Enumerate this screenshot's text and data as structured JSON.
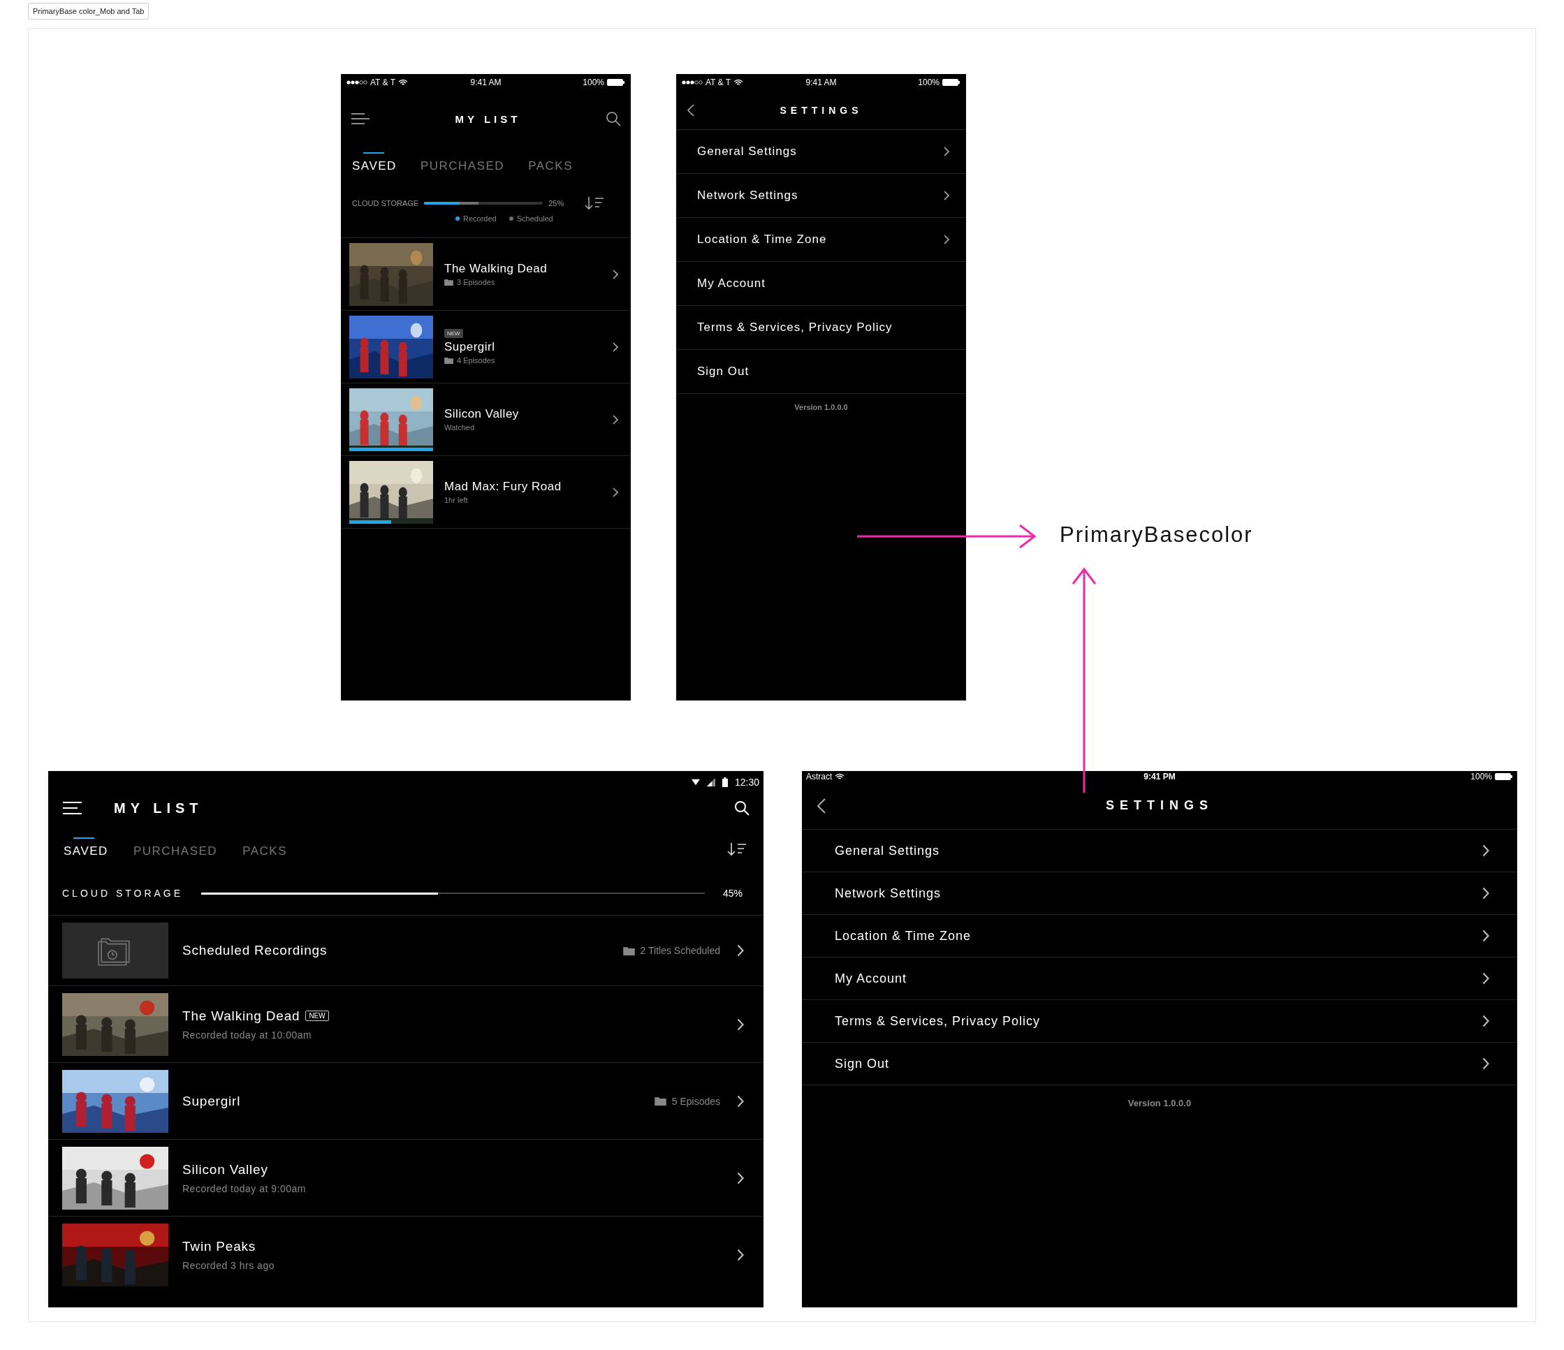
{
  "board_label": "PrimaryBase color_Mob and Tab",
  "phone_my_list": {
    "status_bar": {
      "carrier": "AT & T",
      "time": "9:41 AM",
      "battery": "100%"
    },
    "title": "MY LIST",
    "tabs": [
      {
        "label": "SAVED",
        "selected": true
      },
      {
        "label": "PURCHASED",
        "selected": false
      },
      {
        "label": "PACKS",
        "selected": false
      }
    ],
    "storage": {
      "label": "CLOUD STORAGE",
      "reading": "25%",
      "fills": [
        {
          "color": "#6e6e6e",
          "level": 0.46
        },
        {
          "color": "#1ea7e6",
          "level": 0.3
        }
      ],
      "legend": [
        {
          "label": "Recorded",
          "color": "#1ea7e6"
        },
        {
          "label": "Scheduled",
          "color": "#6e6e6e"
        }
      ]
    },
    "items": [
      {
        "title": "The Walking Dead",
        "subtitle": "3 Episodes",
        "folder": true
      },
      {
        "title": "Supergirl",
        "badge": "NEW",
        "subtitle": "4 Episodes",
        "folder": true
      },
      {
        "title": "Silicon Valley",
        "subtitle": "Watched",
        "folder": false,
        "level": 1
      },
      {
        "title": "Mad Max: Fury Road",
        "subtitle": "1hr left",
        "folder": false,
        "level": 0.5
      }
    ]
  },
  "phone_settings": {
    "status_bar": {
      "carrier": "AT & T",
      "time": "9:41 AM",
      "battery": "100%"
    },
    "title": "SETTINGS",
    "items": [
      {
        "label": "General Settings",
        "chevron": true
      },
      {
        "label": "Network Settings",
        "chevron": true
      },
      {
        "label": "Location & Time Zone",
        "chevron": true
      },
      {
        "label": "My Account",
        "chevron": false
      },
      {
        "label": "Terms & Services, Privacy Policy",
        "chevron": false
      },
      {
        "label": "Sign Out",
        "chevron": false
      }
    ],
    "version": "Version 1.0.0.0"
  },
  "annotation": {
    "label": "PrimaryBasecolor"
  },
  "tablet_my_list": {
    "status_bar": {
      "time": "12:30"
    },
    "title": "MY LIST",
    "tabs": [
      {
        "label": "SAVED",
        "selected": true
      },
      {
        "label": "PURCHASED",
        "selected": false
      },
      {
        "label": "PACKS",
        "selected": false
      }
    ],
    "storage": {
      "label": "CLOUD STORAGE",
      "level": 0.47,
      "reading": "45%"
    },
    "items": [
      {
        "kind": "folder",
        "title": "Scheduled Recordings",
        "meta": "2 Titles Scheduled"
      },
      {
        "kind": "show",
        "title": "The Walking Dead",
        "badge": "NEW",
        "subtitle": "Recorded today at 10:00am"
      },
      {
        "kind": "show",
        "title": "Supergirl",
        "meta": "5 Episodes"
      },
      {
        "kind": "show",
        "title": "Silicon Valley",
        "subtitle": "Recorded today at 9:00am"
      },
      {
        "kind": "show",
        "title": "Twin Peaks",
        "subtitle": "Recorded 3 hrs ago"
      }
    ]
  },
  "tablet_settings": {
    "status_bar": {
      "carrier": "Astract",
      "time": "9:41 PM",
      "battery": "100%"
    },
    "title": "SETTINGS",
    "items": [
      {
        "label": "General Settings",
        "chevron": true
      },
      {
        "label": "Network Settings",
        "chevron": true
      },
      {
        "label": "Location & Time Zone",
        "chevron": true
      },
      {
        "label": "My Account",
        "chevron": true
      },
      {
        "label": "Terms & Services, Privacy Policy",
        "chevron": true
      },
      {
        "label": "Sign Out",
        "chevron": true
      }
    ],
    "version": "Version 1.0.0.0"
  }
}
